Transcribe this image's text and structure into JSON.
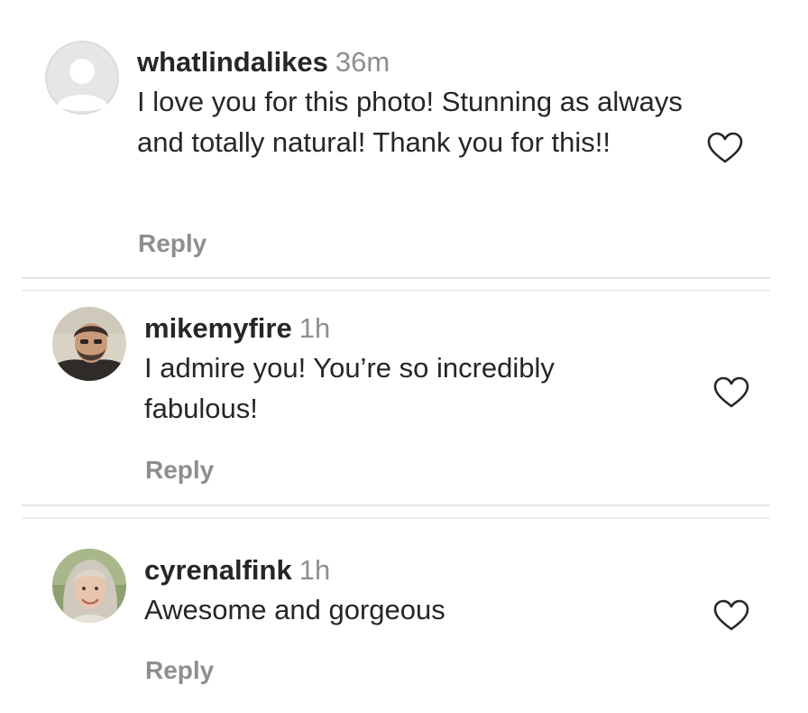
{
  "comments": [
    {
      "username": "whatlindalikes",
      "time": "36m",
      "text": "I love you for this photo! Stunning as always and totally natural! Thank you for this!!",
      "reply_label": "Reply",
      "avatar": "default-avatar-icon",
      "liked": false
    },
    {
      "username": "mikemyfire",
      "time": "1h",
      "text": "I admire you! You’re so incredibly fabulous!",
      "reply_label": "Reply",
      "avatar": "user-photo",
      "liked": false
    },
    {
      "username": "cyrenalfink",
      "time": "1h",
      "text": "Awesome and gorgeous",
      "reply_label": "Reply",
      "avatar": "user-photo",
      "liked": false
    }
  ],
  "colors": {
    "text": "#262626",
    "muted": "#8e8e8e",
    "divider": "#e4e4e4",
    "heart_stroke": "#262626"
  }
}
